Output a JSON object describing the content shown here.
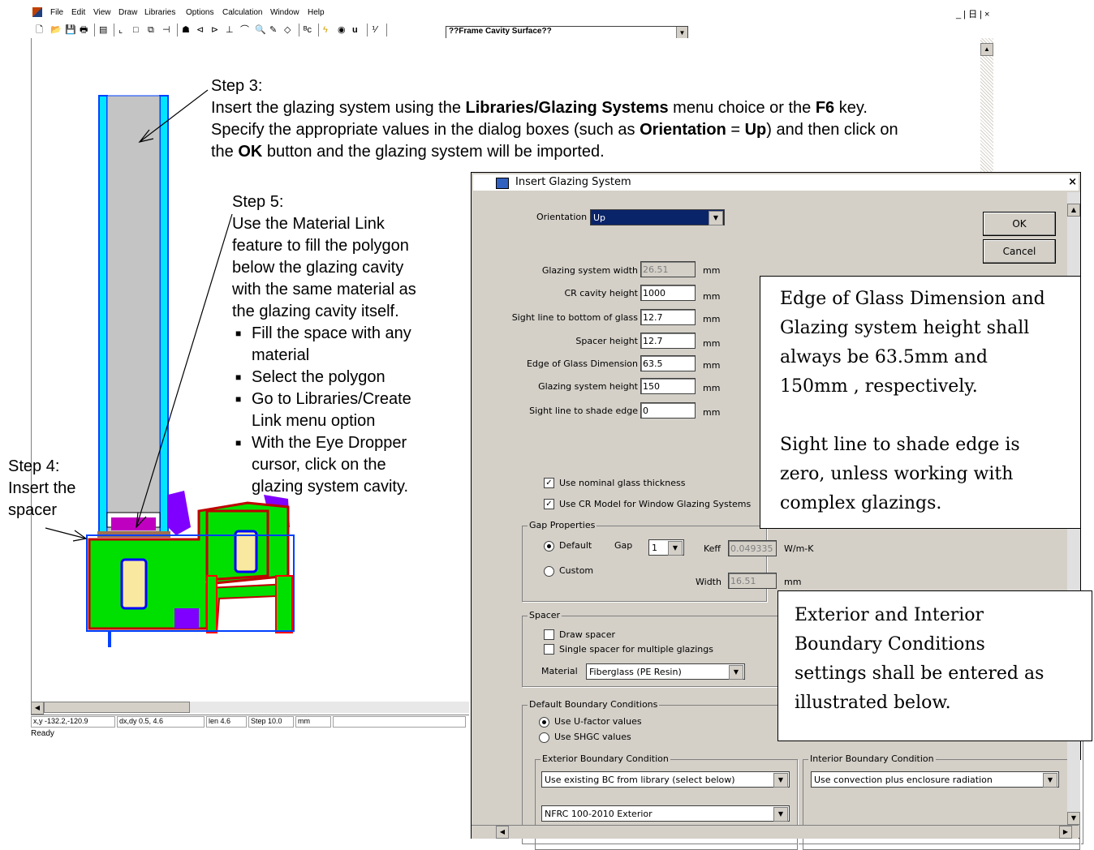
{
  "app": {
    "menu": [
      "File",
      "Edit",
      "View",
      "Draw",
      "Libraries",
      "Options",
      "Calculation",
      "Window",
      "Help"
    ],
    "window_controls": "_ | 日 | ×",
    "toolbar_combo": "??Frame Cavity Surface??",
    "status": {
      "xy": "x,y -132.2,-120.9",
      "dxdy": "dx,dy  0.5, 4.6",
      "len": "len  4.6",
      "step": "Step 10.0",
      "unit": "mm",
      "ready": "Ready"
    }
  },
  "notes": {
    "step3_title": "Step 3:",
    "step3_l1_a": "Insert the glazing system using the ",
    "step3_l1_b": "Libraries/Glazing Systems",
    "step3_l1_c": " menu choice or the ",
    "step3_l1_d": "F6",
    "step3_l1_e": " key.",
    "step3_l2_a": "Specify the appropriate values in the dialog boxes (such as ",
    "step3_l2_b": "Orientation",
    "step3_l2_c": " = ",
    "step3_l2_d": "Up",
    "step3_l2_e": ") and then click on",
    "step3_l3_a": "the ",
    "step3_l3_b": "OK",
    "step3_l3_c": " button and the glazing system will be imported.",
    "step5_lines": [
      "Step 5:",
      "Use the Material Link",
      "feature to fill the polygon",
      "below the glazing cavity",
      "with the same material as",
      "the glazing cavity itself."
    ],
    "step5_bullets": [
      [
        "Fill the space with any",
        "material"
      ],
      [
        "Select the polygon"
      ],
      [
        "Go to Libraries/Create",
        "Link menu option"
      ],
      [
        "With the Eye Dropper",
        "cursor, click on the",
        "glazing system cavity."
      ]
    ],
    "step4_lines": [
      "Step 4:",
      "Insert the",
      "spacer"
    ]
  },
  "dialog": {
    "title": "Insert Glazing System",
    "close": "×",
    "orientation_label": "Orientation",
    "orientation_value": "Up",
    "ok": "OK",
    "cancel": "Cancel",
    "fields": [
      {
        "label": "Glazing system width",
        "value": "26.51",
        "unit": "mm",
        "readonly": true
      },
      {
        "label": "CR cavity height",
        "value": "1000",
        "unit": "mm"
      },
      {
        "label": "Sight line to bottom of glass",
        "value": "12.7",
        "unit": "mm"
      },
      {
        "label": "Spacer height",
        "value": "12.7",
        "unit": "mm"
      },
      {
        "label": "Edge of Glass Dimension",
        "value": "63.5",
        "unit": "mm"
      },
      {
        "label": "Glazing system height",
        "value": "150",
        "unit": "mm"
      },
      {
        "label": "Sight line to shade edge",
        "value": "0",
        "unit": "mm"
      }
    ],
    "chk_nominal": "Use nominal glass thickness",
    "chk_cr_model": "Use CR Model for Window Glazing Systems",
    "gap": {
      "title": "Gap Properties",
      "default": "Default",
      "gap_label": "Gap",
      "gap_value": "1",
      "keff_label": "Keff",
      "keff_value": "0.049335",
      "keff_unit": "W/m-K",
      "custom": "Custom",
      "width_label": "Width",
      "width_value": "16.51",
      "width_unit": "mm"
    },
    "spacer": {
      "title": "Spacer",
      "draw": "Draw spacer",
      "single": "Single spacer for multiple glazings",
      "material_label": "Material",
      "material_value": "Fiberglass (PE Resin)"
    },
    "bc": {
      "title": "Default Boundary Conditions",
      "ufactor": "Use U-factor values",
      "shgc": "Use SHGC values",
      "ext_title": "Exterior Boundary Condition",
      "ext_value": "Use existing BC from library (select below)",
      "ext_lib": "NFRC 100-2010 Exterior",
      "int_title": "Interior Boundary Condition",
      "int_value": "Use convection plus enclosure radiation"
    }
  },
  "callouts": {
    "box1": [
      "Edge of Glass Dimension and",
      "Glazing system height shall",
      "always be 63.5mm and",
      "150mm , respectively.",
      "",
      "Sight line to shade edge is",
      "zero, unless working with",
      "complex glazings."
    ],
    "box2": [
      "Exterior and Interior",
      "Boundary Conditions",
      "settings shall be entered as",
      "illustrated below."
    ]
  }
}
